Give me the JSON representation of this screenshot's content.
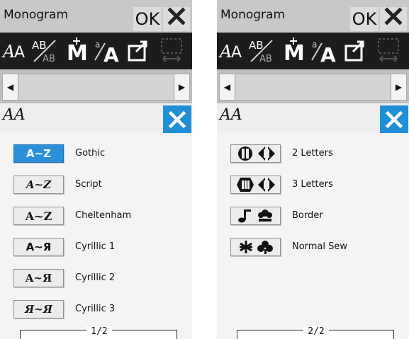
{
  "screens": [
    {
      "title": "Monogram",
      "ok_label": "OK",
      "subheader_icon": "AA",
      "page_indicator": "1/2",
      "scroll_left_icon": "◀",
      "scroll_right_icon": "▶",
      "items": [
        {
          "icon_text": "A~Z",
          "label": "Gothic",
          "selected": true,
          "icon": "gothic-font-icon"
        },
        {
          "icon_text": "A~Z",
          "label": "Script",
          "selected": false,
          "icon": "script-font-icon"
        },
        {
          "icon_text": "A~Z",
          "label": "Cheltenham",
          "selected": false,
          "icon": "cheltenham-font-icon"
        },
        {
          "icon_text": "A~Я",
          "label": "Cyrillic 1",
          "selected": false,
          "icon": "cyrillic-1-font-icon"
        },
        {
          "icon_text": "A~Я",
          "label": "Cyrillic 2",
          "selected": false,
          "icon": "cyrillic-2-font-icon"
        },
        {
          "icon_text": "Я~Я",
          "label": "Cyrillic 3",
          "selected": false,
          "icon": "cyrillic-3-font-icon"
        }
      ]
    },
    {
      "title": "Monogram",
      "ok_label": "OK",
      "subheader_icon": "AA",
      "page_indicator": "2/2",
      "scroll_left_icon": "◀",
      "scroll_right_icon": "▶",
      "items": [
        {
          "label": "2 Letters",
          "selected": false,
          "icon": "two-letters-icon"
        },
        {
          "label": "3 Letters",
          "selected": false,
          "icon": "three-letters-icon"
        },
        {
          "label": "Border",
          "selected": false,
          "icon": "border-icon"
        },
        {
          "label": "Normal Sew",
          "selected": false,
          "icon": "normal-sew-icon"
        }
      ]
    }
  ],
  "toolbar_icons": [
    "font-select-icon",
    "letter-spacing-icon",
    "monogram-m-icon",
    "character-size-icon",
    "return-icon",
    "frame-icon"
  ],
  "colors": {
    "accent": "#2a8fd8",
    "toolbar": "#1c1c1c",
    "titlebar": "#c8c8c8"
  }
}
